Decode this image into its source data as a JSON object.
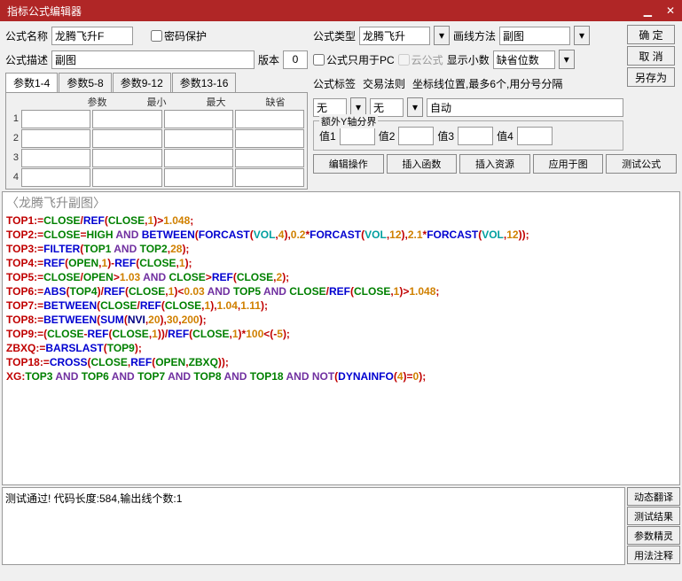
{
  "window": {
    "title": "指标公式编辑器"
  },
  "labels": {
    "fname": "公式名称",
    "pwprotect": "密码保护",
    "fdesc": "公式描述",
    "version": "版本",
    "ftype": "公式类型",
    "drawmethod": "画线方法",
    "pconly": "公式只用于PC",
    "cloud": "云公式",
    "showdec": "显示小数",
    "ftag": "公式标签",
    "traderule": "交易法则",
    "coordline": "坐标线位置,最多6个,用分号分隔",
    "extrayaxis": "额外Y轴分界",
    "v1": "值1",
    "v2": "值2",
    "v3": "值3",
    "v4": "值4",
    "phead": {
      "name": "参数",
      "min": "最小",
      "max": "最大",
      "def": "缺省"
    }
  },
  "values": {
    "fname": "龙腾飞升F",
    "fdesc": "副图",
    "version": "0",
    "ftype": "龙腾飞升",
    "drawmethod": "副图",
    "showdec": "缺省位数",
    "ftag": "无",
    "traderule": "无",
    "coordline": "自动"
  },
  "tabs": {
    "t1": "参数1-4",
    "t2": "参数5-8",
    "t3": "参数9-12",
    "t4": "参数13-16"
  },
  "buttons": {
    "ok": "确 定",
    "cancel": "取 消",
    "saveas": "另存为",
    "editop": "编辑操作",
    "insfn": "插入函数",
    "insres": "插入资源",
    "applychart": "应用于图",
    "testfml": "测试公式",
    "dyntrans": "动态翻译",
    "testresult": "测试结果",
    "paramwiz": "参数精灵",
    "usagecomment": "用法注释"
  },
  "code": {
    "title": "〈龙腾飞升副图〉",
    "lines": [
      [
        [
          "v",
          "TOP1"
        ],
        [
          "o",
          ":="
        ],
        [
          "k",
          "CLOSE"
        ],
        [
          "o",
          "/"
        ],
        [
          "f",
          "REF"
        ],
        [
          "o",
          "("
        ],
        [
          "k",
          "CLOSE"
        ],
        [
          "o",
          ","
        ],
        [
          "n",
          "1"
        ],
        [
          "o",
          ")>"
        ],
        [
          "n",
          "1.048"
        ],
        [
          "o",
          ";"
        ]
      ],
      [
        [
          "v",
          "TOP2"
        ],
        [
          "o",
          ":="
        ],
        [
          "k",
          "CLOSE"
        ],
        [
          "o",
          "="
        ],
        [
          "k",
          "HIGH"
        ],
        [
          "o",
          " "
        ],
        [
          "p",
          "AND"
        ],
        [
          "o",
          " "
        ],
        [
          "f",
          "BETWEEN"
        ],
        [
          "o",
          "("
        ],
        [
          "f",
          "FORCAST"
        ],
        [
          "o",
          "("
        ],
        [
          "t",
          "VOL"
        ],
        [
          "o",
          ","
        ],
        [
          "n",
          "4"
        ],
        [
          "o",
          ")"
        ],
        [
          "o",
          ","
        ],
        [
          "n",
          "0.2"
        ],
        [
          "o",
          "*"
        ],
        [
          "f",
          "FORCAST"
        ],
        [
          "o",
          "("
        ],
        [
          "t",
          "VOL"
        ],
        [
          "o",
          ","
        ],
        [
          "n",
          "12"
        ],
        [
          "o",
          ")"
        ],
        [
          "o",
          ","
        ],
        [
          "n",
          "2.1"
        ],
        [
          "o",
          "*"
        ],
        [
          "f",
          "FORCAST"
        ],
        [
          "o",
          "("
        ],
        [
          "t",
          "VOL"
        ],
        [
          "o",
          ","
        ],
        [
          "n",
          "12"
        ],
        [
          "o",
          ")"
        ],
        [
          "o",
          ");"
        ]
      ],
      [
        [
          "v",
          "TOP3"
        ],
        [
          "o",
          ":="
        ],
        [
          "f",
          "FILTER"
        ],
        [
          "o",
          "("
        ],
        [
          "k",
          "TOP1"
        ],
        [
          "o",
          " "
        ],
        [
          "p",
          "AND"
        ],
        [
          "o",
          " "
        ],
        [
          "k",
          "TOP2"
        ],
        [
          "o",
          ","
        ],
        [
          "n",
          "28"
        ],
        [
          "o",
          ");"
        ]
      ],
      [
        [
          "v",
          "TOP4"
        ],
        [
          "o",
          ":="
        ],
        [
          "f",
          "REF"
        ],
        [
          "o",
          "("
        ],
        [
          "k",
          "OPEN"
        ],
        [
          "o",
          ","
        ],
        [
          "n",
          "1"
        ],
        [
          "o",
          ")-"
        ],
        [
          "f",
          "REF"
        ],
        [
          "o",
          "("
        ],
        [
          "k",
          "CLOSE"
        ],
        [
          "o",
          ","
        ],
        [
          "n",
          "1"
        ],
        [
          "o",
          ");"
        ]
      ],
      [
        [
          "v",
          "TOP5"
        ],
        [
          "o",
          ":="
        ],
        [
          "k",
          "CLOSE"
        ],
        [
          "o",
          "/"
        ],
        [
          "k",
          "OPEN"
        ],
        [
          "o",
          ">"
        ],
        [
          "n",
          "1.03"
        ],
        [
          "o",
          " "
        ],
        [
          "p",
          "AND"
        ],
        [
          "o",
          " "
        ],
        [
          "k",
          "CLOSE"
        ],
        [
          "o",
          ">"
        ],
        [
          "f",
          "REF"
        ],
        [
          "o",
          "("
        ],
        [
          "k",
          "CLOSE"
        ],
        [
          "o",
          ","
        ],
        [
          "n",
          "2"
        ],
        [
          "o",
          ");"
        ]
      ],
      [
        [
          "v",
          "TOP6"
        ],
        [
          "o",
          ":="
        ],
        [
          "f",
          "ABS"
        ],
        [
          "o",
          "("
        ],
        [
          "k",
          "TOP4"
        ],
        [
          "o",
          ")/"
        ],
        [
          "f",
          "REF"
        ],
        [
          "o",
          "("
        ],
        [
          "k",
          "CLOSE"
        ],
        [
          "o",
          ","
        ],
        [
          "n",
          "1"
        ],
        [
          "o",
          ")<"
        ],
        [
          "n",
          "0.03"
        ],
        [
          "o",
          " "
        ],
        [
          "p",
          "AND"
        ],
        [
          "o",
          " "
        ],
        [
          "k",
          "TOP5"
        ],
        [
          "o",
          " "
        ],
        [
          "p",
          "AND"
        ],
        [
          "o",
          " "
        ],
        [
          "k",
          "CLOSE"
        ],
        [
          "o",
          "/"
        ],
        [
          "f",
          "REF"
        ],
        [
          "o",
          "("
        ],
        [
          "k",
          "CLOSE"
        ],
        [
          "o",
          ","
        ],
        [
          "n",
          "1"
        ],
        [
          "o",
          ")>"
        ],
        [
          "n",
          "1.048"
        ],
        [
          "o",
          ";"
        ]
      ],
      [
        [
          "v",
          "TOP7"
        ],
        [
          "o",
          ":="
        ],
        [
          "f",
          "BETWEEN"
        ],
        [
          "o",
          "("
        ],
        [
          "k",
          "CLOSE"
        ],
        [
          "o",
          "/"
        ],
        [
          "f",
          "REF"
        ],
        [
          "o",
          "("
        ],
        [
          "k",
          "CLOSE"
        ],
        [
          "o",
          ","
        ],
        [
          "n",
          "1"
        ],
        [
          "o",
          ")"
        ],
        [
          "o",
          ","
        ],
        [
          "n",
          "1.04"
        ],
        [
          "o",
          ","
        ],
        [
          "n",
          "1.11"
        ],
        [
          "o",
          ");"
        ]
      ],
      [
        [
          "v",
          "TOP8"
        ],
        [
          "o",
          ":="
        ],
        [
          "f",
          "BETWEEN"
        ],
        [
          "o",
          "("
        ],
        [
          "f",
          "SUM"
        ],
        [
          "o",
          "("
        ],
        [
          "nv",
          "NVI"
        ],
        [
          "o",
          ","
        ],
        [
          "n",
          "20"
        ],
        [
          "o",
          ")"
        ],
        [
          "o",
          ","
        ],
        [
          "n",
          "30"
        ],
        [
          "o",
          ","
        ],
        [
          "n",
          "200"
        ],
        [
          "o",
          ");"
        ]
      ],
      [
        [
          "v",
          "TOP9"
        ],
        [
          "o",
          ":=("
        ],
        [
          "k",
          "CLOSE"
        ],
        [
          "o",
          "-"
        ],
        [
          "f",
          "REF"
        ],
        [
          "o",
          "("
        ],
        [
          "k",
          "CLOSE"
        ],
        [
          "o",
          ","
        ],
        [
          "n",
          "1"
        ],
        [
          "o",
          "))/"
        ],
        [
          "f",
          "REF"
        ],
        [
          "o",
          "("
        ],
        [
          "k",
          "CLOSE"
        ],
        [
          "o",
          ","
        ],
        [
          "n",
          "1"
        ],
        [
          "o",
          ")*"
        ],
        [
          "n",
          "100"
        ],
        [
          "o",
          "<(-"
        ],
        [
          "n",
          "5"
        ],
        [
          "o",
          ");"
        ]
      ],
      [
        [
          "v",
          "ZBXQ"
        ],
        [
          "o",
          ":="
        ],
        [
          "f",
          "BARSLAST"
        ],
        [
          "o",
          "("
        ],
        [
          "k",
          "TOP9"
        ],
        [
          "o",
          ");"
        ]
      ],
      [
        [
          "v",
          "TOP18"
        ],
        [
          "o",
          ":="
        ],
        [
          "f",
          "CROSS"
        ],
        [
          "o",
          "("
        ],
        [
          "k",
          "CLOSE"
        ],
        [
          "o",
          ","
        ],
        [
          "f",
          "REF"
        ],
        [
          "o",
          "("
        ],
        [
          "k",
          "OPEN"
        ],
        [
          "o",
          ","
        ],
        [
          "k",
          "ZBXQ"
        ],
        [
          "o",
          "));"
        ]
      ],
      [
        [
          "v",
          "XG"
        ],
        [
          "o",
          ":"
        ],
        [
          "k",
          "TOP3"
        ],
        [
          "o",
          " "
        ],
        [
          "p",
          "AND"
        ],
        [
          "o",
          " "
        ],
        [
          "k",
          "TOP6"
        ],
        [
          "o",
          " "
        ],
        [
          "p",
          "AND"
        ],
        [
          "o",
          " "
        ],
        [
          "k",
          "TOP7"
        ],
        [
          "o",
          " "
        ],
        [
          "p",
          "AND"
        ],
        [
          "o",
          " "
        ],
        [
          "k",
          "TOP8"
        ],
        [
          "o",
          " "
        ],
        [
          "p",
          "AND"
        ],
        [
          "o",
          " "
        ],
        [
          "k",
          "TOP18"
        ],
        [
          "o",
          " "
        ],
        [
          "p",
          "AND"
        ],
        [
          "o",
          " "
        ],
        [
          "p",
          "NOT"
        ],
        [
          "o",
          "("
        ],
        [
          "f",
          "DYNAINFO"
        ],
        [
          "o",
          "("
        ],
        [
          "n",
          "4"
        ],
        [
          "o",
          ")="
        ],
        [
          "n",
          "0"
        ],
        [
          "o",
          ");"
        ]
      ]
    ]
  },
  "status": "测试通过! 代码长度:584,输出线个数:1"
}
